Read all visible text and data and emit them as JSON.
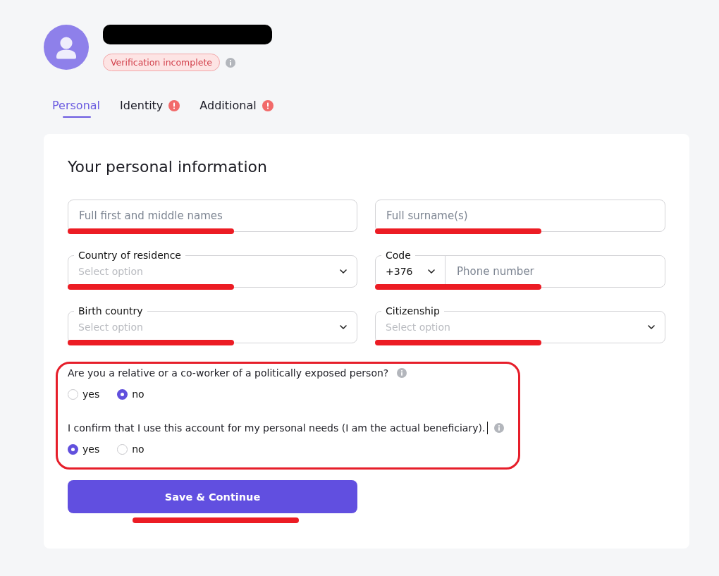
{
  "profile": {
    "name_redacted": true,
    "status_badge": "Verification incomplete",
    "status_info": true
  },
  "tabs": [
    {
      "label": "Personal",
      "selected": true,
      "alert": false
    },
    {
      "label": "Identity",
      "selected": false,
      "alert": true
    },
    {
      "label": "Additional",
      "selected": false,
      "alert": true
    }
  ],
  "form": {
    "title": "Your personal information",
    "fields": [
      {
        "kind": "text",
        "placeholder": "Full first and middle names",
        "underlined": true
      },
      {
        "kind": "text",
        "placeholder": "Full surname(s)",
        "underlined": true
      },
      {
        "kind": "select",
        "label": "Country of residence",
        "placeholder": "Select option",
        "underlined": true
      },
      {
        "kind": "phone",
        "label": "Code",
        "code": "+376",
        "placeholder": "Phone number",
        "underlined": true
      },
      {
        "kind": "select",
        "label": "Birth country",
        "placeholder": "Select option",
        "underlined": true
      },
      {
        "kind": "select",
        "label": "Citizenship",
        "placeholder": "Select option",
        "underlined": true
      }
    ],
    "questions": {
      "highlighted": true,
      "items": [
        {
          "text": "Are you a relative or a co-worker of a politically exposed person?",
          "info": true,
          "cursor": false,
          "options": [
            {
              "label": "yes",
              "selected": false
            },
            {
              "label": "no",
              "selected": true
            }
          ]
        },
        {
          "text": "I confirm that I use this account for my personal needs (I am the actual beneficiary).",
          "info": true,
          "cursor": true,
          "options": [
            {
              "label": "yes",
              "selected": true
            },
            {
              "label": "no",
              "selected": false
            }
          ]
        }
      ]
    },
    "button": {
      "label": "Save & Continue",
      "underlined": true
    }
  }
}
